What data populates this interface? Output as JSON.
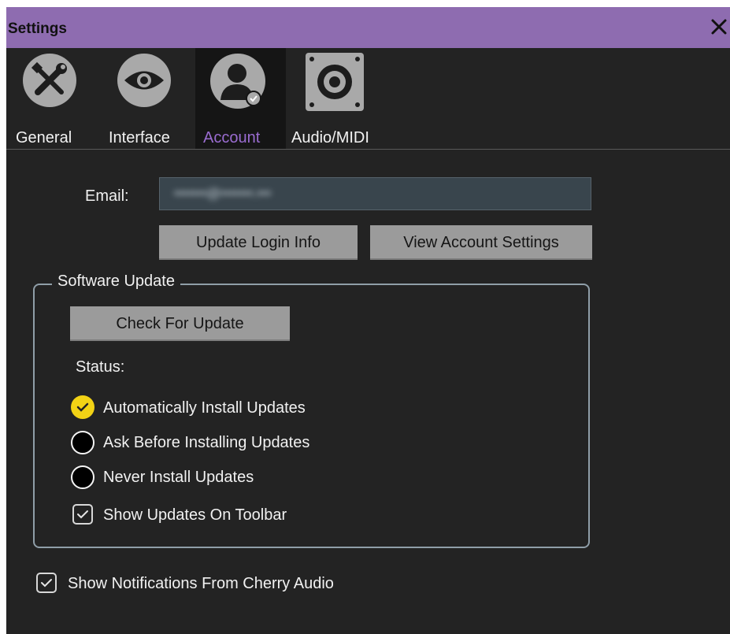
{
  "window": {
    "title": "Settings",
    "close_icon": "close-icon",
    "accent": "#8e6cb0"
  },
  "tabs": [
    {
      "label": "General",
      "icon": "tools-icon",
      "active": false
    },
    {
      "label": "Interface",
      "icon": "eye-icon",
      "active": false
    },
    {
      "label": "Account",
      "icon": "user-icon",
      "active": true
    },
    {
      "label": "Audio/MIDI",
      "icon": "speaker-icon",
      "active": false
    }
  ],
  "account": {
    "email_label": "Email:",
    "email_value": "•••••••@•••••••.•••",
    "update_login_label": "Update Login Info",
    "view_account_label": "View Account Settings"
  },
  "software_update": {
    "title": "Software Update",
    "check_label": "Check For Update",
    "status_label": "Status:",
    "options": [
      {
        "label": "Automatically Install Updates",
        "selected": true
      },
      {
        "label": "Ask Before Installing Updates",
        "selected": false
      },
      {
        "label": "Never Install Updates",
        "selected": false
      }
    ],
    "show_toolbar_label": "Show Updates On Toolbar",
    "show_toolbar_checked": true
  },
  "notifications": {
    "label": "Show Notifications From Cherry Audio",
    "checked": true
  },
  "colors": {
    "selected_radio": "#f2d215",
    "active_tab_label": "#9a6cd0"
  }
}
